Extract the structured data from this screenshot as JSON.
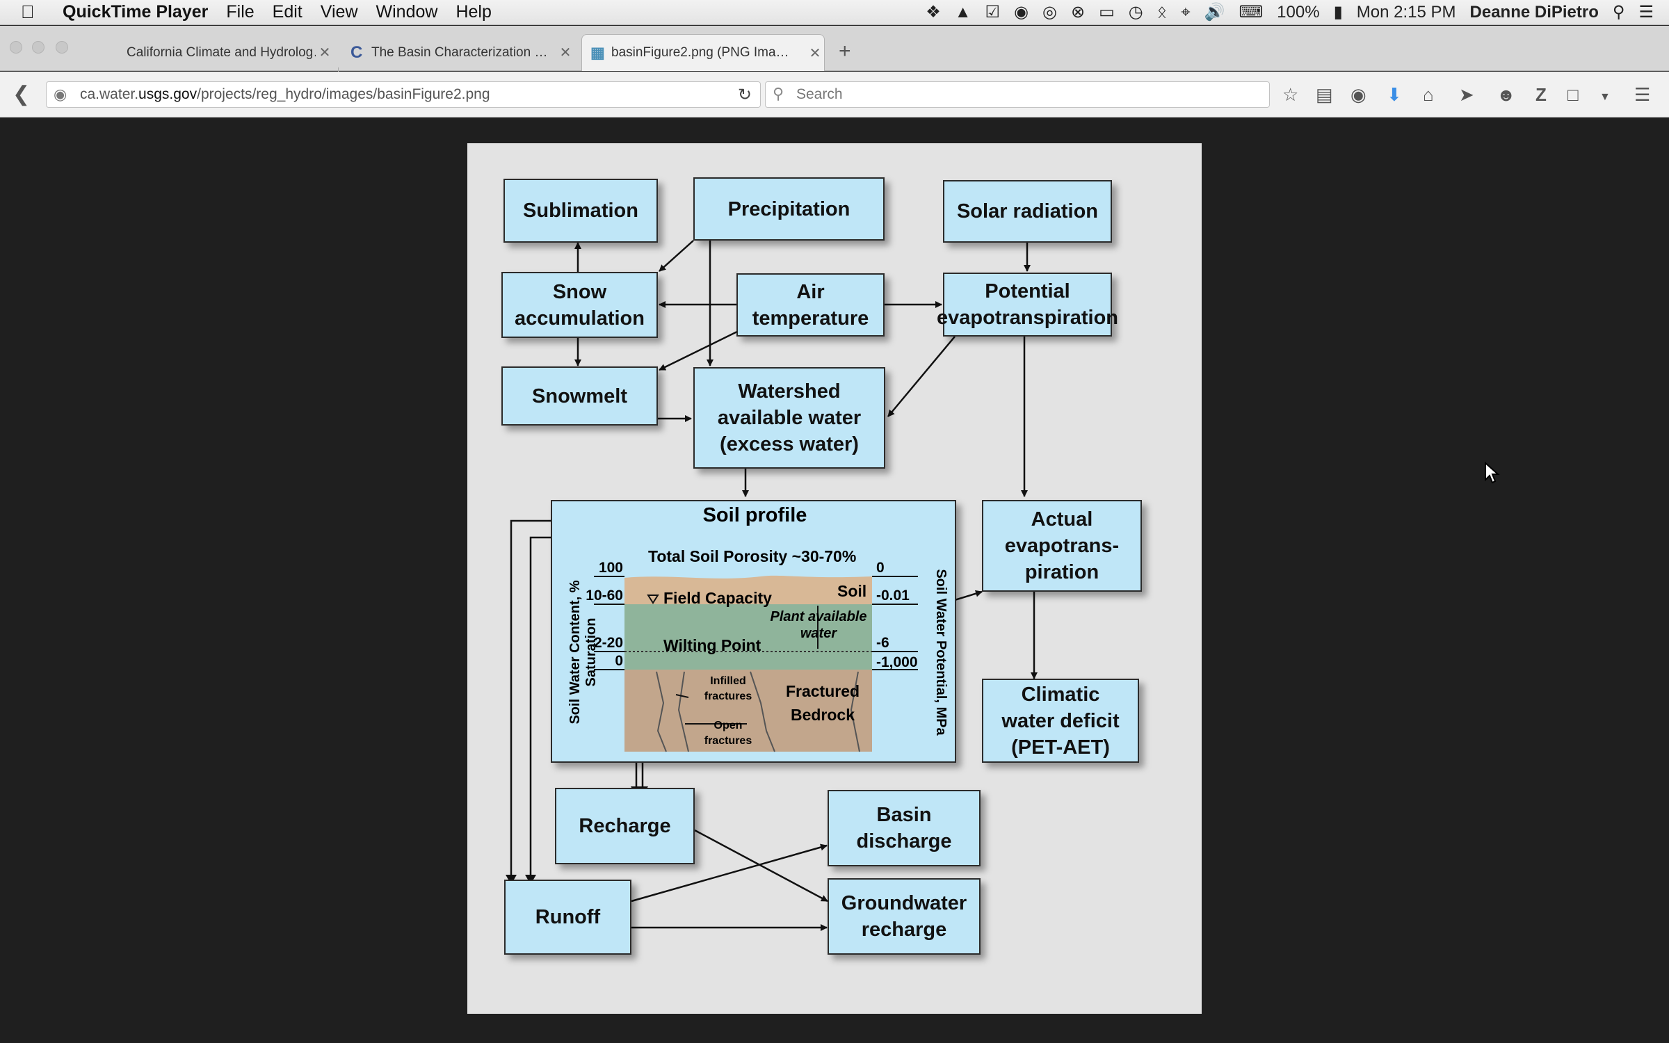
{
  "menubar": {
    "app_name": "QuickTime Player",
    "items": [
      "File",
      "Edit",
      "View",
      "Window",
      "Help"
    ],
    "battery": "100%",
    "clock": "Mon 2:15 PM",
    "user": "Deanne DiPietro"
  },
  "tabs": [
    {
      "title": "California Climate and Hydrolog…",
      "active": false
    },
    {
      "title": "The Basin Characterization …",
      "active": false
    },
    {
      "title": "basinFigure2.png (PNG Ima…",
      "active": true
    }
  ],
  "navbar": {
    "url_prefix": "ca.water.",
    "url_domain": "usgs.gov",
    "url_path": "/projects/reg_hydro/images/basinFigure2.png",
    "search_placeholder": "Search"
  },
  "diagram": {
    "sublimation": "Sublimation",
    "precipitation": "Precipitation",
    "solar_radiation": "Solar radiation",
    "snow_accumulation": [
      "Snow",
      "accumulation"
    ],
    "air_temperature": [
      "Air",
      "temperature"
    ],
    "potential_et": [
      "Potential",
      "evapotranspiration"
    ],
    "snowmelt": "Snowmelt",
    "watershed": [
      "Watershed",
      "available water",
      "(excess water)"
    ],
    "soil_profile": {
      "title": "Soil profile",
      "porosity": "Total Soil Porosity ~30-70%",
      "left_axis": "Soil Water Content, % Saturation",
      "right_axis": "Soil Water Potential, MPa",
      "left_ticks": [
        "100",
        "10-60",
        "2-20",
        "0"
      ],
      "right_ticks": [
        "0",
        "-0.01",
        "-6",
        "-1,000"
      ],
      "field_capacity": "Field Capacity",
      "soil": "Soil",
      "plant_available": [
        "Plant available",
        "water"
      ],
      "wilting_point": "Wilting Point",
      "infilled": [
        "Infilled",
        "fractures"
      ],
      "open": [
        "Open",
        "fractures"
      ],
      "bedrock": [
        "Fractured",
        "Bedrock"
      ]
    },
    "actual_et": [
      "Actual",
      "evapotrans-",
      "piration"
    ],
    "climatic_deficit": [
      "Climatic",
      "water deficit",
      "(PET-AET)"
    ],
    "recharge": "Recharge",
    "basin_discharge": [
      "Basin",
      "discharge"
    ],
    "runoff": "Runoff",
    "groundwater_recharge": [
      "Groundwater",
      "recharge"
    ]
  }
}
